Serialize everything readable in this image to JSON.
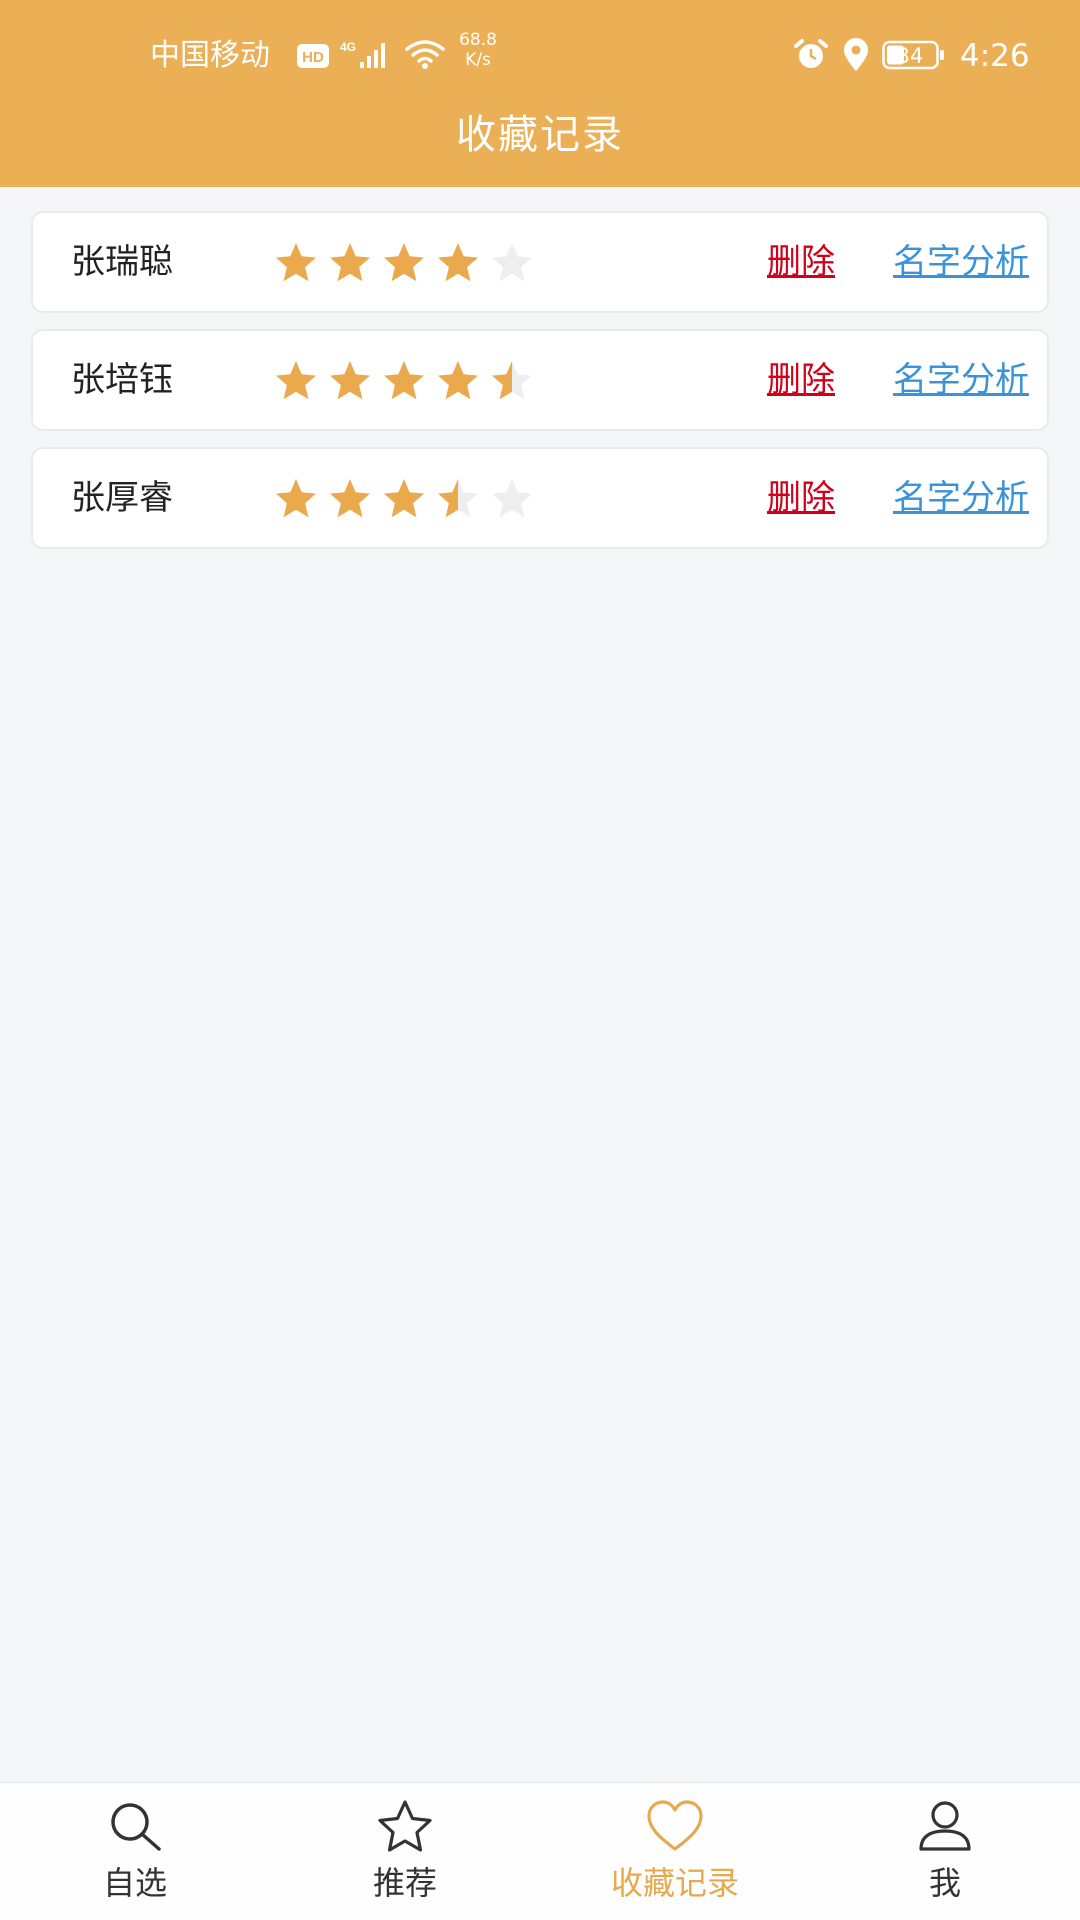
{
  "status_bar": {
    "carrier": "中国移动",
    "hd_badge": "HD",
    "network": "4G",
    "speed_value": "68.8",
    "speed_unit": "K/s",
    "battery": "34",
    "time": "4:26"
  },
  "header": {
    "title": "收藏记录"
  },
  "colors": {
    "header_bg": "#ebaf55",
    "star_filled": "#eaa94c",
    "star_empty": "#eeeeee",
    "delete_link": "#d0021b",
    "analyze_link": "#3a93d8",
    "active_tab": "#e8a84c"
  },
  "favorites": [
    {
      "name": "张瑞聪",
      "rating": 4,
      "delete_label": "删除",
      "analyze_label": "名字分析"
    },
    {
      "name": "张培钰",
      "rating": 4.5,
      "delete_label": "删除",
      "analyze_label": "名字分析"
    },
    {
      "name": "张厚睿",
      "rating": 3.5,
      "delete_label": "删除",
      "analyze_label": "名字分析"
    }
  ],
  "tabbar": {
    "items": [
      {
        "label": "自选",
        "icon": "search-icon",
        "active": false
      },
      {
        "label": "推荐",
        "icon": "star-icon",
        "active": false
      },
      {
        "label": "收藏记录",
        "icon": "heart-icon",
        "active": true
      },
      {
        "label": "我",
        "icon": "person-icon",
        "active": false
      }
    ]
  }
}
